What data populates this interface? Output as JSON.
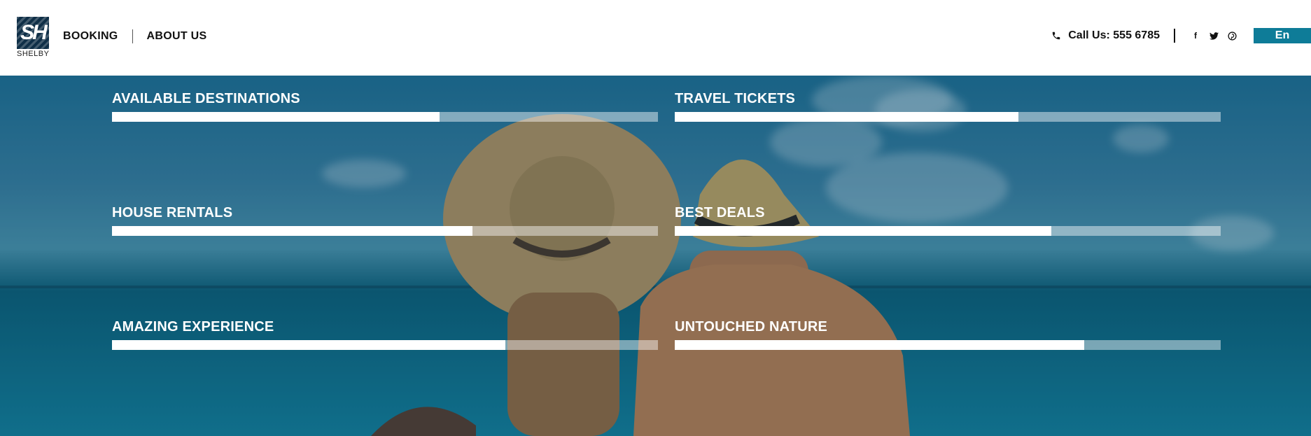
{
  "header": {
    "logo_text": "SH",
    "brand_name": "SHELBY",
    "nav": [
      {
        "label": "BOOKING"
      },
      {
        "label": "ABOUT US"
      }
    ],
    "phone": "Call Us: 555 6785",
    "social": [
      {
        "icon": "facebook-icon",
        "glyph": "f"
      },
      {
        "icon": "twitter-icon",
        "glyph": "🐦"
      },
      {
        "icon": "pinterest-icon",
        "glyph": "℗"
      }
    ],
    "language_button": "En",
    "accent_color": "#0e7c98"
  },
  "skills": [
    {
      "label": "AVAILABLE DESTINATIONS",
      "percent": 60
    },
    {
      "label": "TRAVEL TICKETS",
      "percent": 63
    },
    {
      "label": "HOUSE RENTALS",
      "percent": 66
    },
    {
      "label": "BEST DEALS",
      "percent": 69
    },
    {
      "label": "AMAZING EXPERIENCE",
      "percent": 72
    },
    {
      "label": "UNTOUCHED NATURE",
      "percent": 75
    }
  ]
}
